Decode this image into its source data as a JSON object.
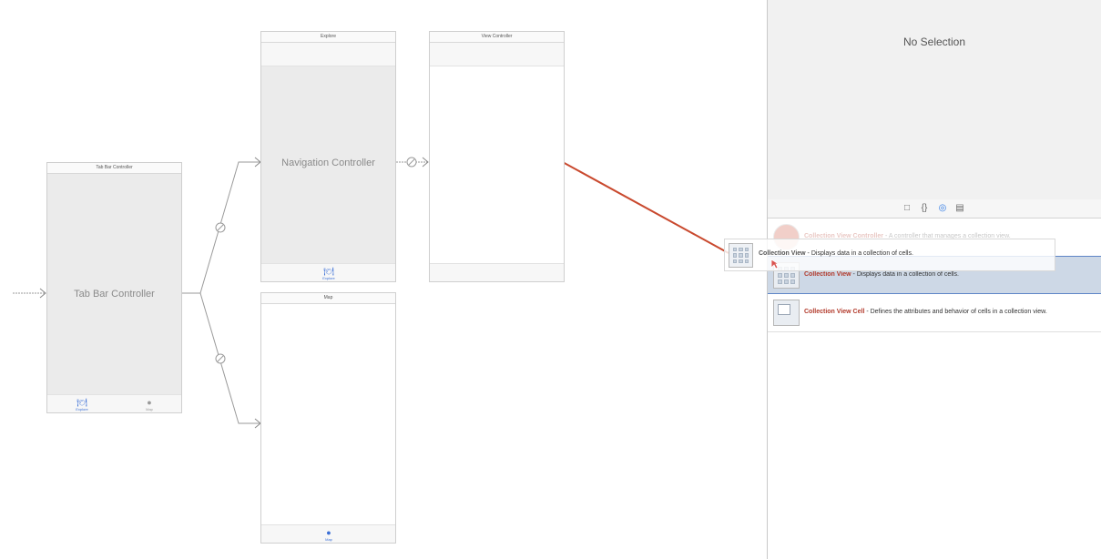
{
  "canvas": {
    "tab_bar_scene": {
      "title": "Tab Bar Controller",
      "label": "Tab Bar Controller",
      "tabs": [
        {
          "label": "Explore",
          "icon": "fork-knife-icon"
        },
        {
          "label": "Map",
          "icon": "map-pin-icon"
        }
      ]
    },
    "nav_scene": {
      "title": "Explore",
      "label": "Navigation Controller",
      "tab_label": "Explore"
    },
    "view_scene": {
      "title": "View Controller"
    },
    "map_scene": {
      "title": "Map",
      "tab_label": "Map"
    }
  },
  "inspector": {
    "no_selection": "No Selection",
    "library_tabs": [
      "file-icon",
      "braces-icon",
      "object-icon",
      "media-icon"
    ],
    "items": [
      {
        "name": "Collection View Controller",
        "desc": " - A controller that manages a collection view.",
        "state": "faded"
      },
      {
        "name": "Collection View",
        "desc": " - Displays data in a collection of cells.",
        "state": "selected"
      },
      {
        "name": "Collection View Cell",
        "desc": " - Defines the attributes and behavior of cells in a collection view.",
        "state": "normal"
      }
    ]
  },
  "drag": {
    "name": "Collection View",
    "desc": " - Displays data in a collection of cells."
  },
  "colors": {
    "accent": "#2f7ae5",
    "arrow": "#c9492e",
    "item_name": "#b23a2b",
    "selection": "#cdd8e6"
  }
}
